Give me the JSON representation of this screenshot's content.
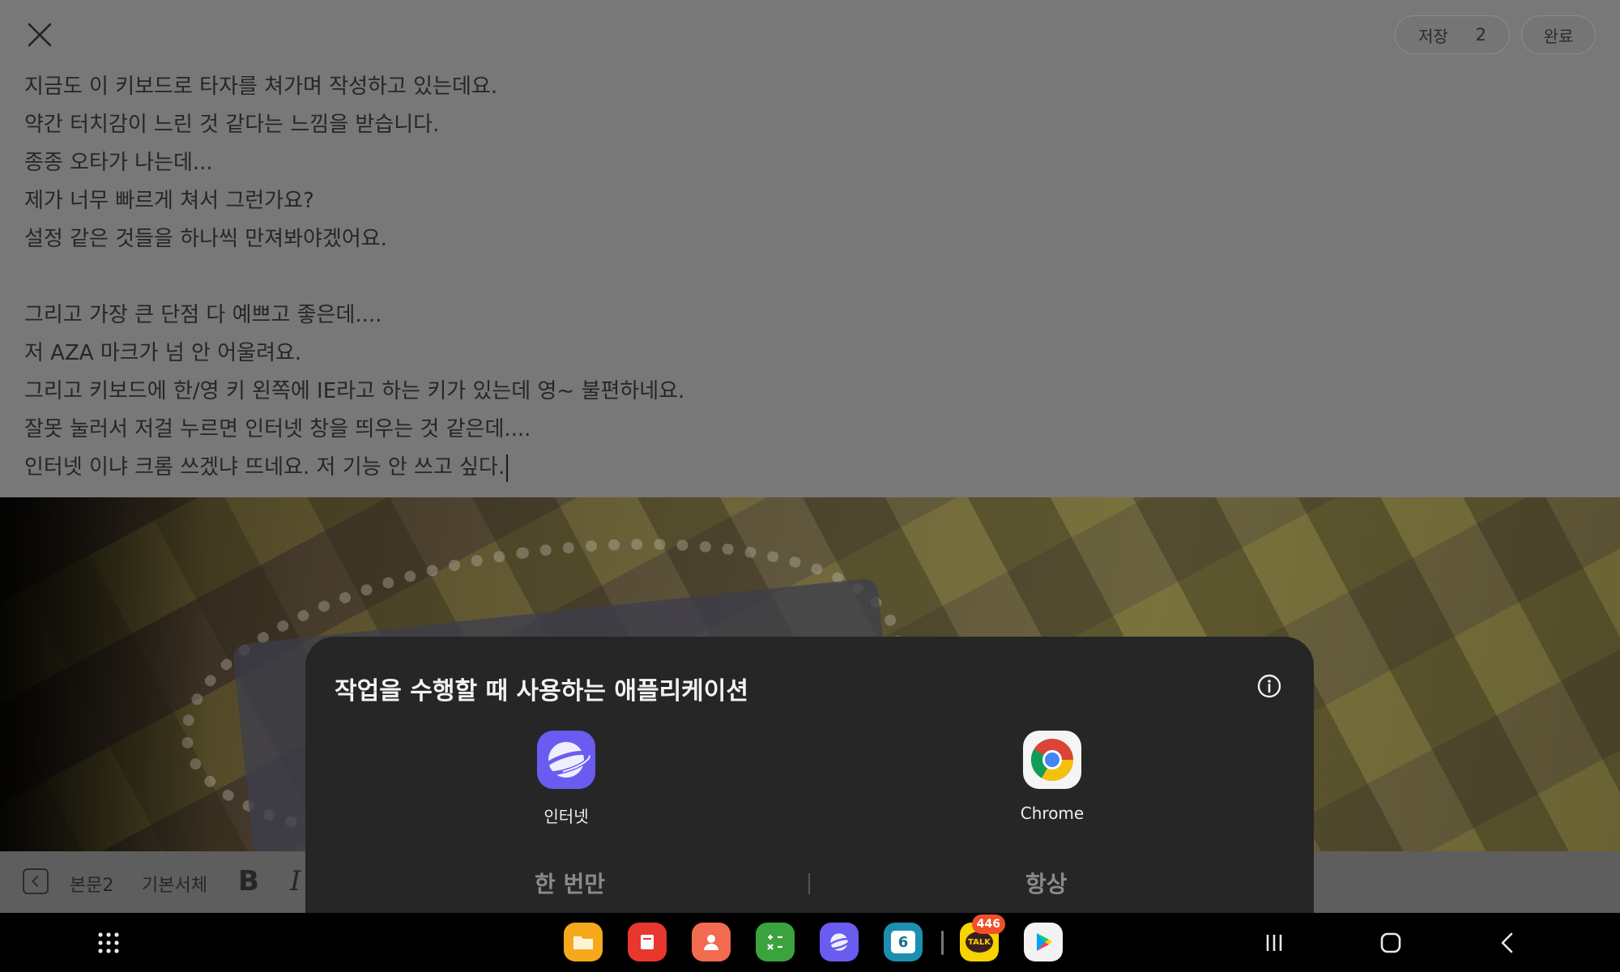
{
  "editor": {
    "save_label": "저장",
    "save_count": "2",
    "done_label": "완료",
    "lines": [
      "지금도 이 키보드로 타자를 쳐가며 작성하고 있는데요.",
      "약간 터치감이 느린 것 같다는 느낌을 받습니다.",
      "종종 오타가 나는데...",
      "제가 너무 빠르게 쳐서 그런가요?",
      "설정 같은 것들을 하나씩 만져봐야겠어요.",
      "",
      "그리고 가장 큰 단점 다 예쁘고 좋은데....",
      "저 AZA 마크가 넘 안 어울려요.",
      "그리고 키보드에 한/영 키 왼쪽에 IE라고 하는 키가 있는데 영~ 불편하네요.",
      "잘못 눌러서 저걸 누르면 인터넷 창을 띄우는 것 같은데....",
      "인터넷 이냐 크롬 쓰겠냐 뜨네요. 저 기능 안 쓰고 싶다."
    ]
  },
  "format_toolbar": {
    "style_label": "본문2",
    "font_label": "기본서체",
    "bold_label": "B",
    "italic_label": "I"
  },
  "app_chooser": {
    "title": "작업을 수행할 때 사용하는 애플리케이션",
    "apps": [
      {
        "label": "인터넷",
        "icon": "samsung-internet-icon"
      },
      {
        "label": "Chrome",
        "icon": "chrome-icon"
      }
    ],
    "just_once_label": "한 번만",
    "always_label": "항상"
  },
  "navbar": {
    "dock_apps": [
      "my-files-icon",
      "samsung-notes-icon",
      "contacts-icon",
      "calculator-icon",
      "samsung-internet-icon",
      "calendar-icon",
      "kakaotalk-icon",
      "play-store-icon"
    ],
    "calendar_day": "6",
    "kakao_text": "TALK",
    "kakao_badge": "446"
  },
  "colors": {
    "editor_bg": "#787878",
    "sheet_bg": "#262626",
    "internet_purple": "#6a5cf0",
    "kakao_yellow": "#f5d400",
    "badge_orange": "#f0502a"
  }
}
